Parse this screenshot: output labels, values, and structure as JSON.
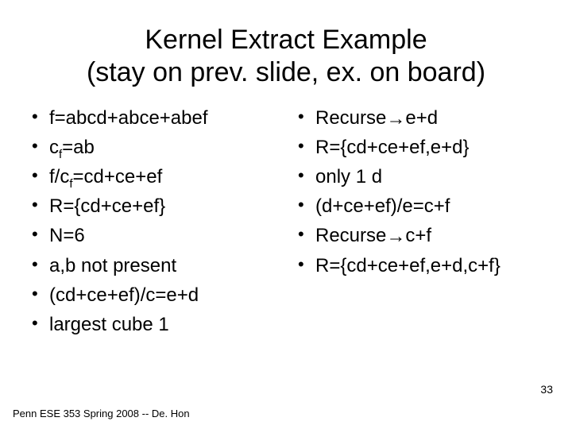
{
  "title_line1": "Kernel Extract Example",
  "title_line2": "(stay on prev. slide, ex. on board)",
  "left": [
    {
      "text": "f=abcd+abce+abef"
    },
    {
      "pre": "c",
      "sub": "f",
      "post": "=ab"
    },
    {
      "pre": "f/c",
      "sub": "f",
      "post": "=cd+ce+ef"
    },
    {
      "text": "R={cd+ce+ef}"
    },
    {
      "text": "N=6"
    },
    {
      "text": "a,b not present"
    },
    {
      "text": "(cd+ce+ef)/c=e+d"
    },
    {
      "text": "largest cube 1"
    }
  ],
  "right": [
    {
      "pre": "Recurse",
      "arrow": true,
      "post": "e+d"
    },
    {
      "text": "R={cd+ce+ef,e+d}"
    },
    {
      "text": "only 1 d"
    },
    {
      "text": "(d+ce+ef)/e=c+f"
    },
    {
      "pre": "Recurse",
      "arrow": true,
      "post": "c+f"
    },
    {
      "text": "R={cd+ce+ef,e+d,c+f}"
    }
  ],
  "footer": "Penn ESE 353 Spring 2008 -- De. Hon",
  "page_number": "33"
}
